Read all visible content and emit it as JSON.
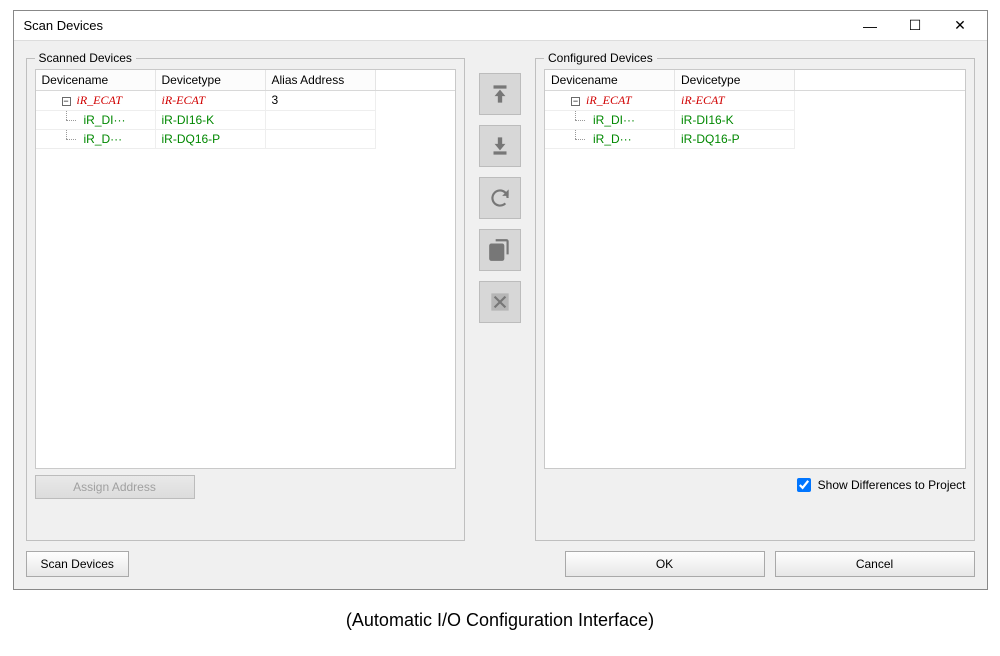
{
  "window": {
    "title": "Scan Devices"
  },
  "win_controls": {
    "min": "—",
    "max": "☐",
    "close": "✕"
  },
  "scanned": {
    "legend": "Scanned Devices",
    "headers": {
      "c1": "Devicename",
      "c2": "Devicetype",
      "c3": "Alias Address"
    },
    "rows": [
      {
        "lvl": 1,
        "name": "iR_ECAT",
        "type": "iR-ECAT",
        "alias": "3",
        "style": "red-it",
        "expander": "−"
      },
      {
        "lvl": 2,
        "name": "iR_DI···",
        "type": "iR-DI16-K",
        "alias": "",
        "style": "green"
      },
      {
        "lvl": 2,
        "name": "iR_D···",
        "type": "iR-DQ16-P",
        "alias": "",
        "style": "green"
      }
    ]
  },
  "configured": {
    "legend": "Configured Devices",
    "headers": {
      "c1": "Devicename",
      "c2": "Devicetype"
    },
    "rows": [
      {
        "lvl": 1,
        "name": "iR_ECAT",
        "type": "iR-ECAT",
        "style": "red-it",
        "expander": "−"
      },
      {
        "lvl": 2,
        "name": "iR_DI···",
        "type": "iR-DI16-K",
        "style": "green"
      },
      {
        "lvl": 2,
        "name": "iR_D···",
        "type": "iR-DQ16-P",
        "style": "green"
      }
    ]
  },
  "mid_buttons": [
    {
      "name": "move-up-button",
      "icon": "up"
    },
    {
      "name": "move-down-button",
      "icon": "down"
    },
    {
      "name": "sync-button",
      "icon": "sync"
    },
    {
      "name": "copy-button",
      "icon": "copy"
    },
    {
      "name": "remove-button",
      "icon": "remove"
    }
  ],
  "assign_address": {
    "label": "Assign Address"
  },
  "show_diff": {
    "label": "Show Differences to Project",
    "checked": true
  },
  "footer": {
    "scan": "Scan Devices",
    "ok": "OK",
    "cancel": "Cancel"
  },
  "caption": "(Automatic I/O Configuration Interface)"
}
